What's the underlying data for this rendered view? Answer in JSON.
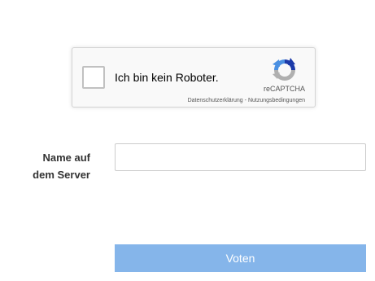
{
  "recaptcha": {
    "checkbox_label": "Ich bin kein Roboter.",
    "brand": "reCAPTCHA",
    "privacy_link": "Datenschutzerklärung",
    "separator": " - ",
    "terms_link": "Nutzungsbedingungen",
    "checked": false,
    "logo_icon": "recaptcha-logo-icon",
    "colors": {
      "logo_blue": "#1c3aa9",
      "logo_light_blue": "#4a90e2",
      "logo_gray": "#b0b0b0"
    }
  },
  "form": {
    "name_label_line1": "Name auf",
    "name_label_line2": "dem Server",
    "name_value": "",
    "name_placeholder": "",
    "submit_label": "Voten"
  },
  "colors": {
    "button_bg": "#85b5ea",
    "button_text": "#ffffff",
    "label_text": "#333333"
  }
}
